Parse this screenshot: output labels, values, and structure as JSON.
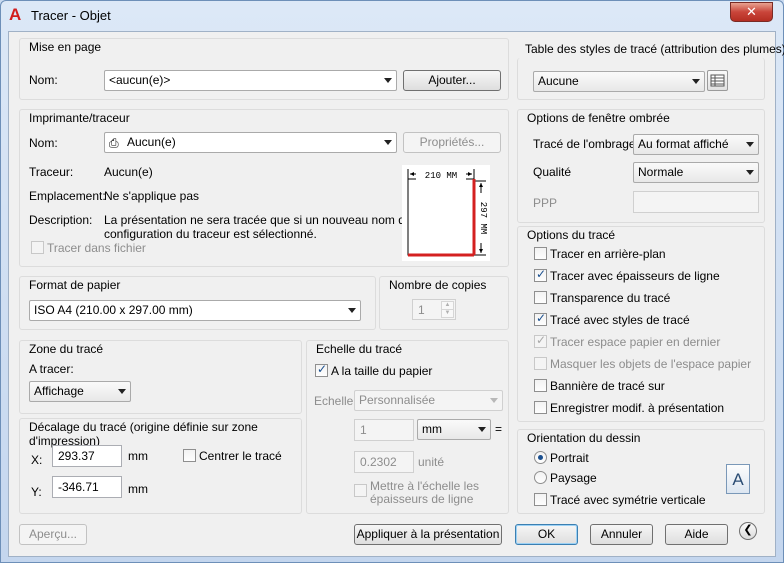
{
  "window": {
    "title": "Tracer - Objet",
    "close_glyph": "✕",
    "app_icon": "autocad-a-icon"
  },
  "page_setup": {
    "title": "Mise en page",
    "name_label": "Nom:",
    "name_value": "<aucun(e)>",
    "add_button": "Ajouter..."
  },
  "plotter": {
    "title": "Imprimante/traceur",
    "name_label": "Nom:",
    "name_value": "Aucun(e)",
    "properties_button": "Propriétés...",
    "plotter_label": "Traceur:",
    "plotter_value": "Aucun(e)",
    "location_label": "Emplacement:",
    "location_value": "Ne s'applique pas",
    "description_label": "Description:",
    "description_line1": "La présentation ne sera tracée que si un nouveau nom de",
    "description_line2": "configuration du traceur est sélectionné.",
    "plot_to_file": "Tracer dans fichier",
    "preview_width": "210 MM",
    "preview_height": "297 MM"
  },
  "paper_size": {
    "title": "Format de papier",
    "value": "ISO A4 (210.00 x 297.00 mm)"
  },
  "copies": {
    "title": "Nombre de copies",
    "value": "1"
  },
  "plot_area": {
    "title": "Zone du tracé",
    "what_label": "A tracer:",
    "what_value": "Affichage"
  },
  "plot_offset": {
    "title": "Décalage du tracé (origine définie sur zone d'impression)",
    "x_label": "X:",
    "x_value": "293.37",
    "x_unit": "mm",
    "y_label": "Y:",
    "y_value": "-346.71",
    "y_unit": "mm",
    "center_label": "Centrer le tracé"
  },
  "plot_scale": {
    "title": "Echelle du tracé",
    "fit_paper": "A la taille du papier",
    "scale_label": "Echelle:",
    "scale_value": "Personnalisée",
    "value1": "1",
    "unit1": "mm",
    "equals": "=",
    "value2": "0.2302",
    "unit2": "unité",
    "lineweights_line1": "Mettre à l'échelle les",
    "lineweights_line2": "épaisseurs de ligne"
  },
  "plot_style_table": {
    "title": "Table des styles de tracé (attribution des plumes)",
    "value": "Aucune",
    "edit_icon": "edit-table-icon"
  },
  "shaded_viewport": {
    "title": "Options de fenêtre ombrée",
    "shade_label": "Tracé de l'ombrage",
    "shade_value": "Au format affiché",
    "quality_label": "Qualité",
    "quality_value": "Normale",
    "dpi_label": "PPP",
    "dpi_value": ""
  },
  "plot_options": {
    "title": "Options du tracé",
    "items": [
      {
        "label": "Tracer en arrière-plan",
        "checked": false,
        "disabled": false
      },
      {
        "label": "Tracer avec épaisseurs de ligne",
        "checked": true,
        "disabled": false
      },
      {
        "label": "Transparence du tracé",
        "checked": false,
        "disabled": false
      },
      {
        "label": "Tracé avec styles de tracé",
        "checked": true,
        "disabled": false
      },
      {
        "label": "Tracer espace papier en dernier",
        "checked": true,
        "disabled": true
      },
      {
        "label": "Masquer les objets de l'espace papier",
        "checked": false,
        "disabled": true
      },
      {
        "label": "Bannière de tracé sur",
        "checked": false,
        "disabled": false
      },
      {
        "label": "Enregistrer modif. à présentation",
        "checked": false,
        "disabled": false
      }
    ]
  },
  "orientation": {
    "title": "Orientation du dessin",
    "portrait": "Portrait",
    "landscape": "Paysage",
    "upside_down": "Tracé avec symétrie verticale",
    "icon_letter": "A"
  },
  "footer": {
    "preview": "Aperçu...",
    "apply": "Appliquer à la présentation",
    "ok": "OK",
    "cancel": "Annuler",
    "help": "Aide",
    "collapse_glyph": "❮"
  },
  "colors": {
    "preview_accent": "#d42020",
    "title_close": "#c9453a"
  }
}
